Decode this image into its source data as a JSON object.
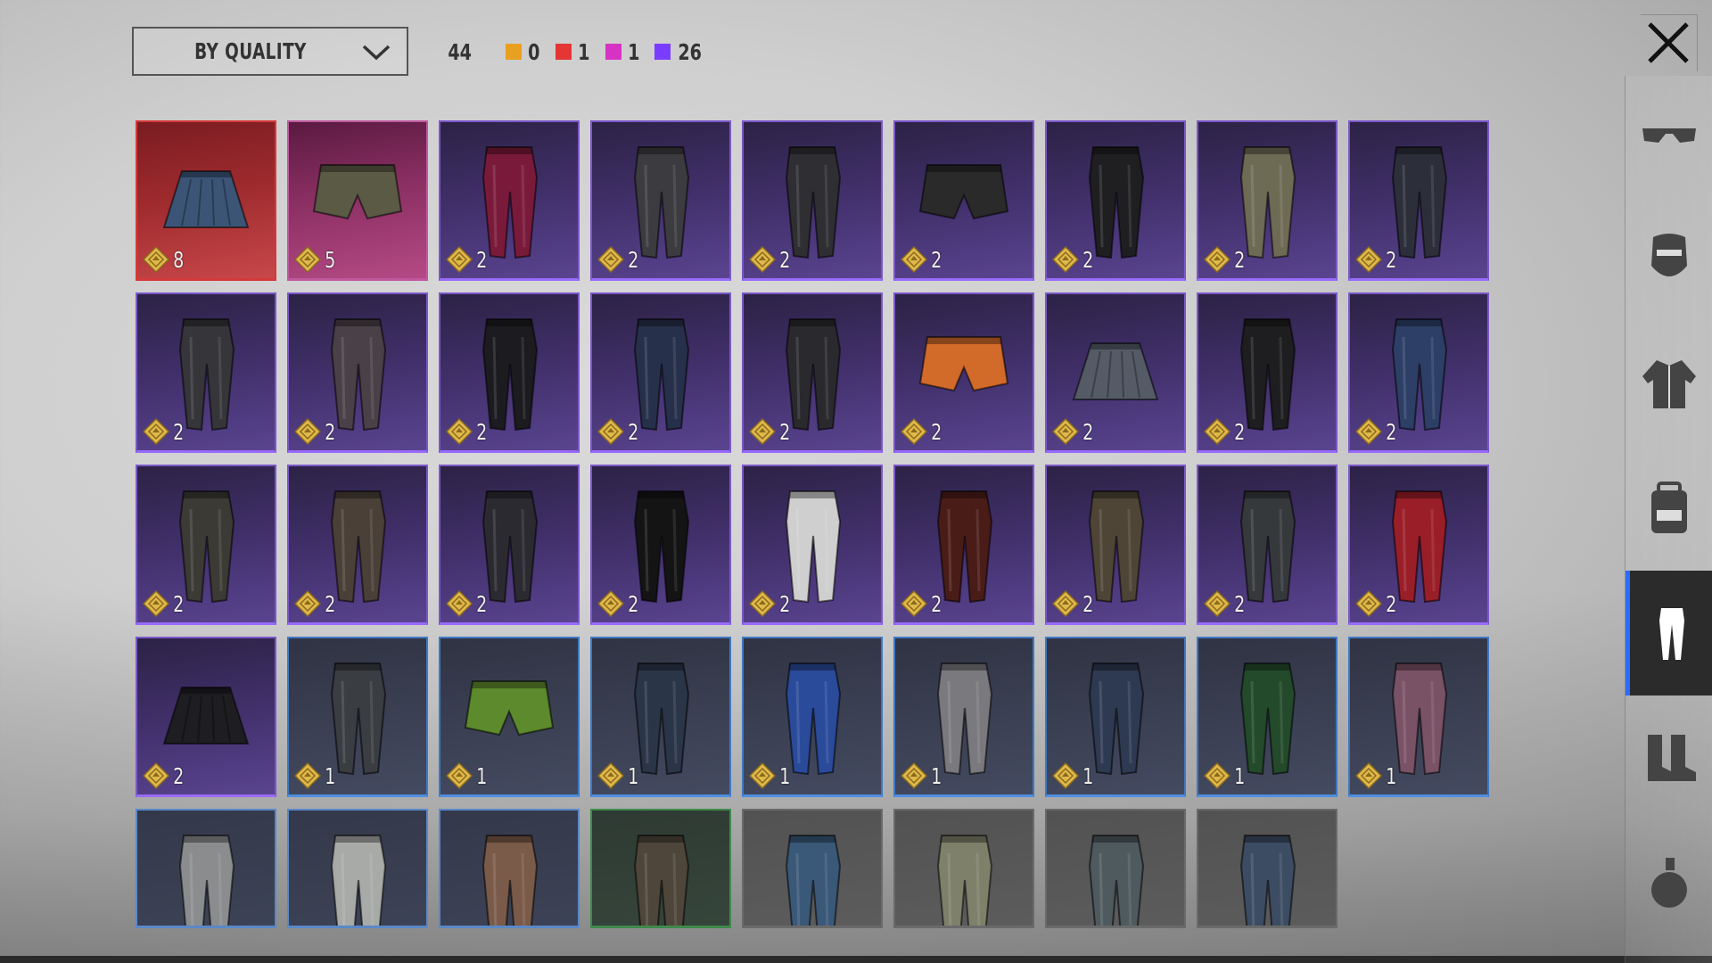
{
  "toolbar": {
    "sort_label": "BY QUALITY",
    "total_count": "44",
    "quality_counts": [
      {
        "name": "legendary",
        "color": "#e8a020",
        "value": "0"
      },
      {
        "name": "epic-red",
        "color": "#e53535",
        "value": "1"
      },
      {
        "name": "epic-pink",
        "color": "#d633c4",
        "value": "1"
      },
      {
        "name": "rare-purple",
        "color": "#7a3dff",
        "value": "26"
      }
    ]
  },
  "close_icon": "close-icon",
  "items": [
    {
      "quality": "red",
      "type": "skirt",
      "color": "#3c5577",
      "count": "8"
    },
    {
      "quality": "pink",
      "type": "shorts",
      "color": "#5b5a45",
      "count": "5"
    },
    {
      "quality": "purple",
      "type": "pants",
      "color": "#7a1a3a",
      "count": "2"
    },
    {
      "quality": "purple",
      "type": "pants",
      "color": "#3c3c40",
      "count": "2"
    },
    {
      "quality": "purple",
      "type": "pants",
      "color": "#2e2e33",
      "count": "2"
    },
    {
      "quality": "purple",
      "type": "shorts",
      "color": "#2a2a2a",
      "count": "2"
    },
    {
      "quality": "purple",
      "type": "pants",
      "color": "#1f1f22",
      "count": "2"
    },
    {
      "quality": "purple",
      "type": "pants",
      "color": "#6e6b55",
      "count": "2"
    },
    {
      "quality": "purple",
      "type": "pants",
      "color": "#2c2f3a",
      "count": "2"
    },
    {
      "quality": "purple",
      "type": "pants",
      "color": "#35353a",
      "count": "2"
    },
    {
      "quality": "purple",
      "type": "pants",
      "color": "#4a4048",
      "count": "2"
    },
    {
      "quality": "purple",
      "type": "pants",
      "color": "#1c1c20",
      "count": "2"
    },
    {
      "quality": "purple",
      "type": "pants",
      "color": "#27304a",
      "count": "2"
    },
    {
      "quality": "purple",
      "type": "pants",
      "color": "#2a2a2e",
      "count": "2"
    },
    {
      "quality": "purple",
      "type": "shorts",
      "color": "#d26a2a",
      "count": "2"
    },
    {
      "quality": "purple",
      "type": "skirt",
      "color": "#555b66",
      "count": "2"
    },
    {
      "quality": "purple",
      "type": "pants",
      "color": "#1e1e20",
      "count": "2"
    },
    {
      "quality": "purple",
      "type": "pants",
      "color": "#2d3f66",
      "count": "2"
    },
    {
      "quality": "purple",
      "type": "pants",
      "color": "#3b3a35",
      "count": "2"
    },
    {
      "quality": "purple",
      "type": "pants",
      "color": "#4a4038",
      "count": "2"
    },
    {
      "quality": "purple",
      "type": "pants",
      "color": "#2b2a30",
      "count": "2"
    },
    {
      "quality": "purple",
      "type": "pants",
      "color": "#141414",
      "count": "2"
    },
    {
      "quality": "purple",
      "type": "pants",
      "color": "#cfcfcf",
      "count": "2"
    },
    {
      "quality": "purple",
      "type": "pants",
      "color": "#4a1c18",
      "count": "2"
    },
    {
      "quality": "purple",
      "type": "pants",
      "color": "#4e4536",
      "count": "2"
    },
    {
      "quality": "purple",
      "type": "pants",
      "color": "#36393b",
      "count": "2"
    },
    {
      "quality": "purple",
      "type": "pants",
      "color": "#9a1e28",
      "count": "2"
    },
    {
      "quality": "purple",
      "type": "skirt",
      "color": "#1e1e22",
      "count": "2"
    },
    {
      "quality": "blue",
      "type": "pants",
      "color": "#3a3d42",
      "count": "1"
    },
    {
      "quality": "blue",
      "type": "shorts",
      "color": "#5d8a2c",
      "count": "1"
    },
    {
      "quality": "blue",
      "type": "pants",
      "color": "#2b3548",
      "count": "1"
    },
    {
      "quality": "blue",
      "type": "pants",
      "color": "#2a4a9a",
      "count": "1"
    },
    {
      "quality": "blue",
      "type": "pants",
      "color": "#7a7a7e",
      "count": "1"
    },
    {
      "quality": "blue",
      "type": "pants",
      "color": "#2e3a52",
      "count": "1"
    },
    {
      "quality": "blue",
      "type": "pants",
      "color": "#234a2a",
      "count": "1"
    },
    {
      "quality": "blue",
      "type": "pants",
      "color": "#7a5266",
      "count": "1"
    },
    {
      "quality": "blue-lite",
      "type": "pants",
      "color": "#8a8c8e",
      "count": ""
    },
    {
      "quality": "blue-lite",
      "type": "pants",
      "color": "#a8aaa8",
      "count": ""
    },
    {
      "quality": "blue-lite",
      "type": "pants",
      "color": "#7a5a48",
      "count": ""
    },
    {
      "quality": "green",
      "type": "pants",
      "color": "#4e463a",
      "count": ""
    },
    {
      "quality": "gray",
      "type": "pants",
      "color": "#3a5878",
      "count": ""
    },
    {
      "quality": "gray",
      "type": "pants",
      "color": "#7e806a",
      "count": ""
    },
    {
      "quality": "gray",
      "type": "pants",
      "color": "#4e5a5e",
      "count": ""
    },
    {
      "quality": "gray",
      "type": "pants",
      "color": "#3c4c62",
      "count": ""
    }
  ],
  "sidebar": [
    {
      "icon": "glasses-icon",
      "active": false
    },
    {
      "icon": "mask-icon",
      "active": false
    },
    {
      "icon": "jacket-icon",
      "active": false
    },
    {
      "icon": "backpack-icon",
      "active": false
    },
    {
      "icon": "pants-icon",
      "active": true
    },
    {
      "icon": "boots-icon",
      "active": false
    },
    {
      "icon": "grenade-icon",
      "active": false
    }
  ]
}
